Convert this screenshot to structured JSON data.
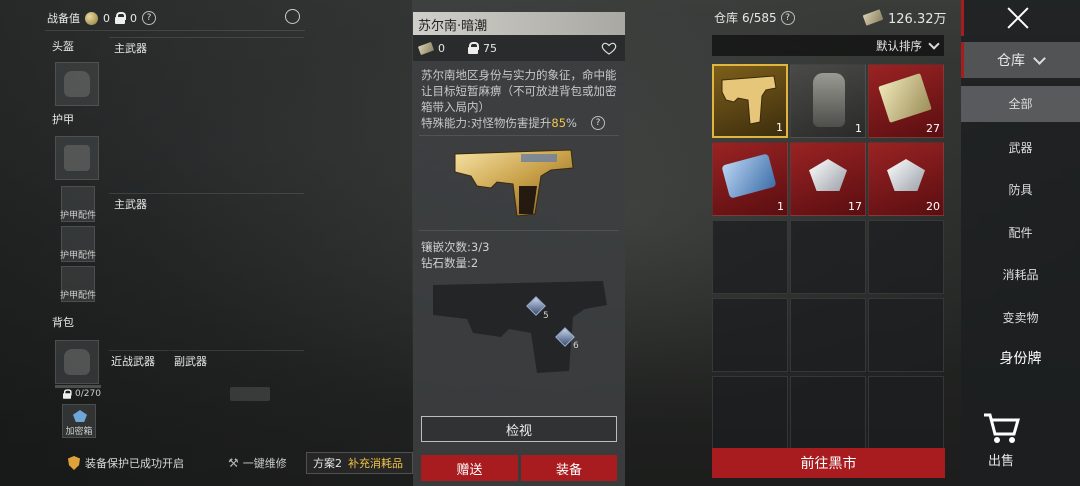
{
  "loadout": {
    "value_label": "战备值",
    "coin_value": "0",
    "lock_value": "0",
    "help": "?",
    "helmet_label": "头盔",
    "armor_label": "护甲",
    "armor_attach_label": "护甲配件",
    "backpack_label": "背包",
    "primary_label": "主武器",
    "melee_label": "近战武器",
    "secondary_label": "副武器",
    "backpack_capacity": "0/270",
    "encrypted_box_label": "加密箱",
    "protection_status": "装备保护已成功开启",
    "repair_label": "一键维修",
    "plan_label": "方案2",
    "supply_label": "补充消耗品"
  },
  "detail": {
    "title": "苏尔南·暗潮",
    "price": "0",
    "lock_count": "75",
    "description": "苏尔南地区身份与实力的象征，命中能让目标短暂麻痹（不可放进背包或加密箱带入局内）",
    "ability_prefix": "特殊能力:对怪物伤害提升",
    "ability_value": "85",
    "ability_unit": "%",
    "inlay_count": "镶嵌次数:3/3",
    "diamond_count": "钻石数量:2",
    "slot_a": "5",
    "slot_b": "6",
    "inspect_button": "检视",
    "gift_button": "赠送",
    "equip_button": "装备"
  },
  "inventory": {
    "label": "仓库",
    "capacity": "6/585",
    "money": "126.32万",
    "sort_label": "默认排序",
    "market_button": "前往黑市",
    "items": [
      {
        "name": "gold-pistol-item",
        "count": "1",
        "rarity": "gold"
      },
      {
        "name": "backpack-item",
        "count": "1",
        "rarity": "dark"
      },
      {
        "name": "cash-stack-item",
        "count": "27",
        "rarity": "red"
      },
      {
        "name": "blue-card-item",
        "count": "1",
        "rarity": "red"
      },
      {
        "name": "diamond-item",
        "count": "17",
        "rarity": "red"
      },
      {
        "name": "diamond-item",
        "count": "20",
        "rarity": "red"
      }
    ]
  },
  "nav": {
    "header": "仓库",
    "items": [
      "全部",
      "武器",
      "防具",
      "配件",
      "消耗品",
      "变卖物",
      "身份牌"
    ],
    "sell_label": "出售"
  },
  "colors": {
    "accent_red": "#a81b1f",
    "highlight_gold": "#f3c545",
    "rarity_gold": "#e0b640"
  }
}
